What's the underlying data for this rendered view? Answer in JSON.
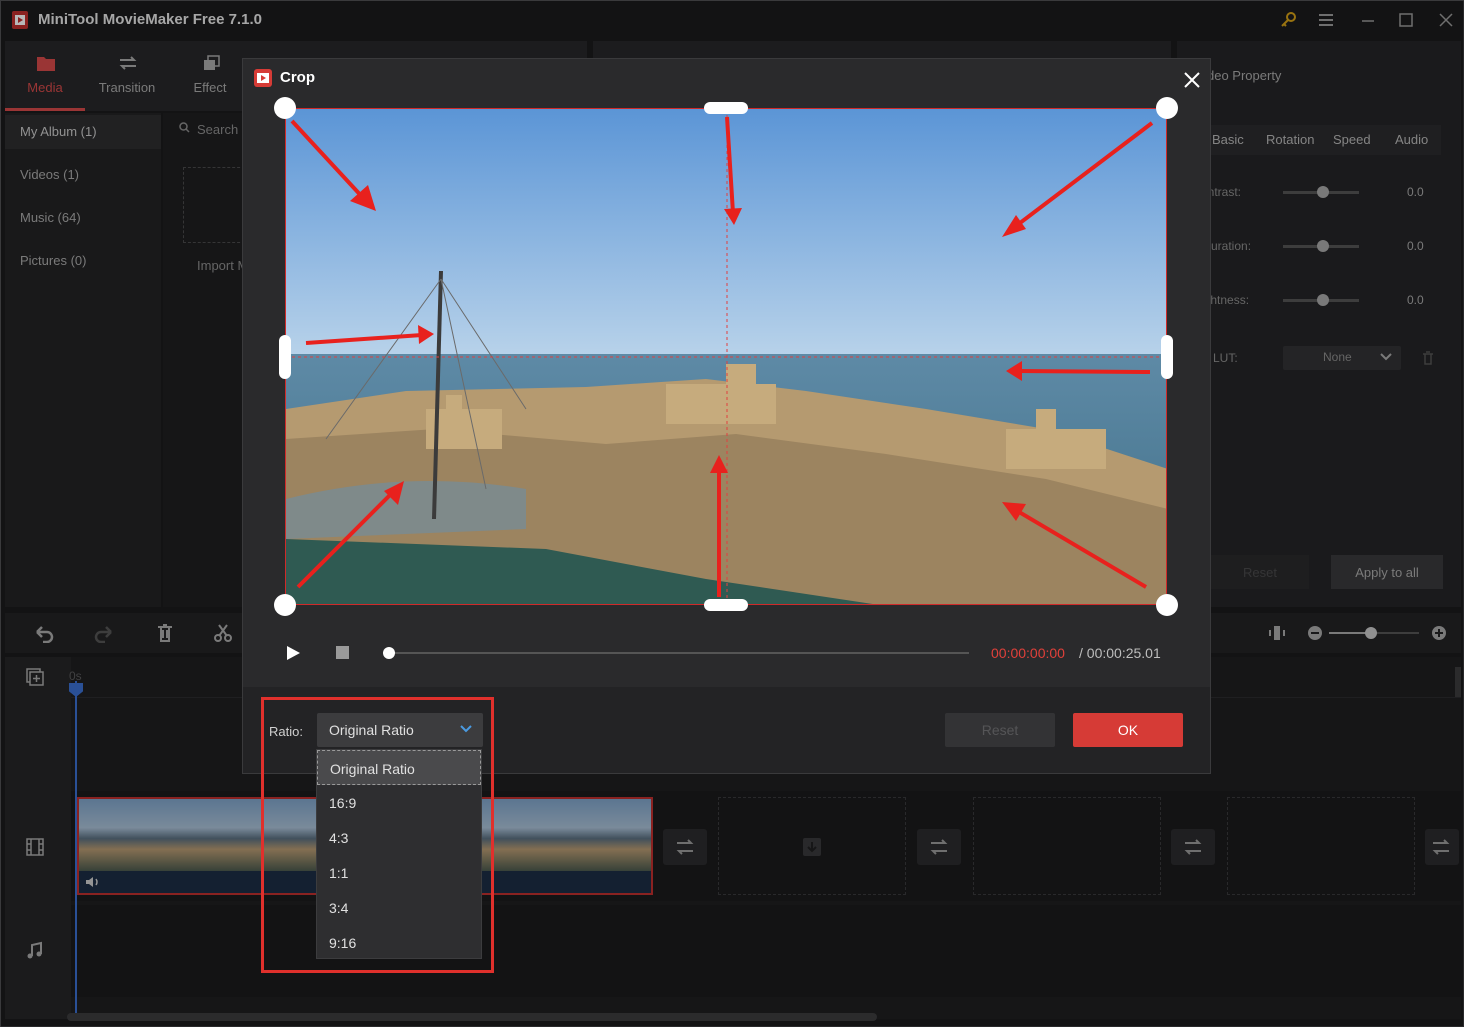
{
  "app": {
    "title": "MiniTool MovieMaker Free 7.1.0"
  },
  "toolbar": {
    "items": [
      {
        "label": "Media",
        "icon": "folder-icon",
        "active": true
      },
      {
        "label": "Transition",
        "icon": "transition-icon"
      },
      {
        "label": "Effect",
        "icon": "effect-icon"
      }
    ]
  },
  "media_nav": {
    "items": [
      {
        "label": "My Album (1)"
      },
      {
        "label": "Videos (1)"
      },
      {
        "label": "Music (64)"
      },
      {
        "label": "Pictures (0)"
      }
    ],
    "search_label": "Search",
    "import_label": "Import M"
  },
  "property": {
    "title": "deo Property",
    "tabs": [
      "Basic",
      "Rotation",
      "Speed",
      "Audio"
    ],
    "rows": [
      {
        "label": "ontrast:",
        "value": "0.0"
      },
      {
        "label": "aturation:",
        "value": "0.0"
      },
      {
        "label": "ightness:",
        "value": "0.0"
      }
    ],
    "lut_label": "D LUT:",
    "lut_value": "None",
    "reset_label": "Reset",
    "apply_label": "Apply to all"
  },
  "timeline": {
    "ruler_start": "0s"
  },
  "crop": {
    "title": "Crop",
    "time_current": "00:00:00:00",
    "time_total": "/ 00:00:25.01",
    "playback_progress": 0,
    "ratio_label": "Ratio:",
    "ratio_selected": "Original Ratio",
    "ratio_options": [
      "Original Ratio",
      "16:9",
      "4:3",
      "1:1",
      "3:4",
      "9:16"
    ],
    "reset_label": "Reset",
    "ok_label": "OK"
  },
  "colors": {
    "accent": "#d63b36",
    "playhead": "#3b6fd0",
    "annotation": "#e0302c"
  }
}
